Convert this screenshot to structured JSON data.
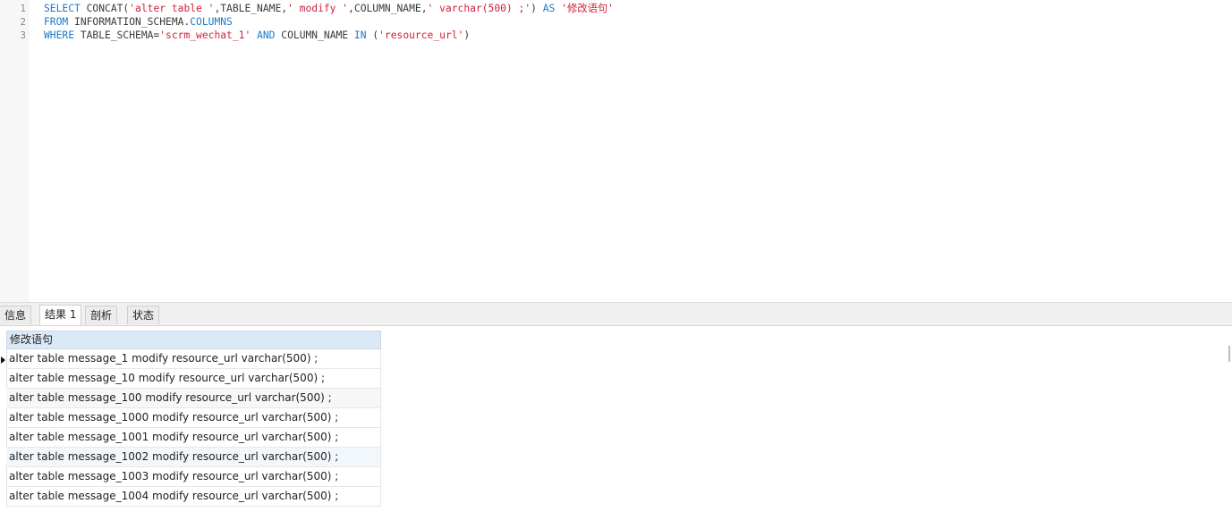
{
  "editor": {
    "line_numbers": [
      "1",
      "2",
      "3"
    ],
    "lines": [
      [
        {
          "t": "SELECT",
          "c": "kw"
        },
        {
          "t": " CONCAT(",
          "c": "plain"
        },
        {
          "t": "'alter table '",
          "c": "str"
        },
        {
          "t": ",TABLE_NAME,",
          "c": "plain"
        },
        {
          "t": "' modify '",
          "c": "str"
        },
        {
          "t": ",COLUMN_NAME,",
          "c": "plain"
        },
        {
          "t": "' varchar(500) ;'",
          "c": "str"
        },
        {
          "t": ") ",
          "c": "plain"
        },
        {
          "t": "AS",
          "c": "kw"
        },
        {
          "t": " ",
          "c": "plain"
        },
        {
          "t": "'修改语句'",
          "c": "str"
        }
      ],
      [
        {
          "t": "FROM",
          "c": "kw"
        },
        {
          "t": " INFORMATION_SCHEMA.",
          "c": "plain"
        },
        {
          "t": "COLUMNS",
          "c": "kw"
        }
      ],
      [
        {
          "t": "WHERE",
          "c": "kw"
        },
        {
          "t": " TABLE_SCHEMA=",
          "c": "plain"
        },
        {
          "t": "'scrm_wechat_1'",
          "c": "str"
        },
        {
          "t": " ",
          "c": "plain"
        },
        {
          "t": "AND",
          "c": "kw"
        },
        {
          "t": " COLUMN_NAME ",
          "c": "plain"
        },
        {
          "t": "IN",
          "c": "kw"
        },
        {
          "t": " (",
          "c": "plain"
        },
        {
          "t": "'resource_url'",
          "c": "str"
        },
        {
          "t": ")",
          "c": "plain"
        }
      ]
    ]
  },
  "tabs": {
    "info": "信息",
    "result1": "结果 1",
    "profile": "剖析",
    "status": "状态",
    "active": "result1"
  },
  "grid": {
    "column_header": "修改语句",
    "rows": [
      "alter table message_1 modify resource_url varchar(500) ;",
      "alter table message_10 modify resource_url varchar(500) ;",
      "alter table message_100 modify resource_url varchar(500) ;",
      "alter table message_1000 modify resource_url varchar(500) ;",
      "alter table message_1001 modify resource_url varchar(500) ;",
      "alter table message_1002 modify resource_url varchar(500) ;",
      "alter table message_1003 modify resource_url varchar(500) ;",
      "alter table message_1004 modify resource_url varchar(500) ;"
    ],
    "current_row_index": 0,
    "hover_row_index": 5
  },
  "colors": {
    "keyword": "#1f78c8",
    "string": "#d0213c",
    "header_bg": "#dbe8f5"
  }
}
